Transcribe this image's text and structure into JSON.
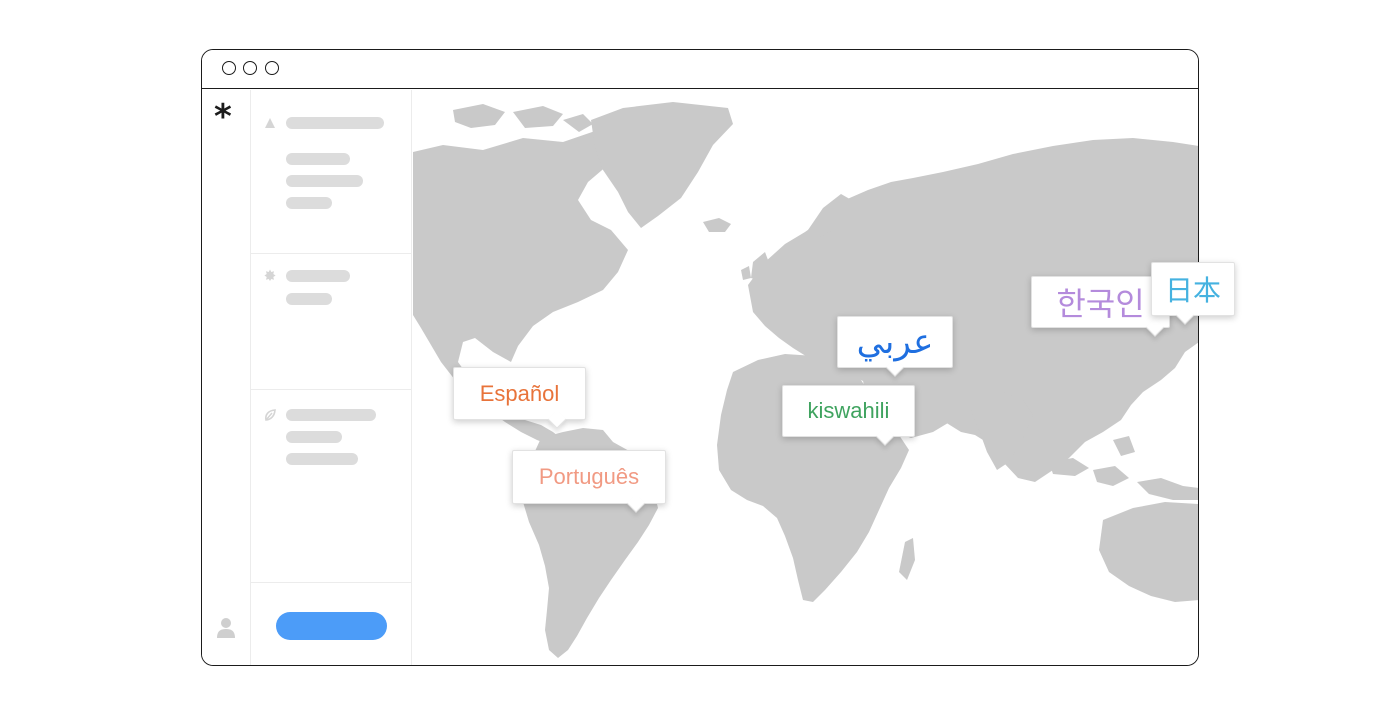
{
  "app": {
    "logo_glyph": "*"
  },
  "colors": {
    "map_land": "#c9c9c9",
    "placeholder": "#dcdcdc",
    "primary_button": "#4c9cf8",
    "espanol": "#e8733a",
    "portugues": "#f19a83",
    "arabic": "#1f6fe0",
    "kiswahili": "#3fa35f",
    "korean": "#b48bdc",
    "japanese": "#45b2e0"
  },
  "sidebar": {
    "sections": [
      {
        "icon": "triangle-icon"
      },
      {
        "icon": "badge-icon"
      },
      {
        "icon": "leaf-icon"
      }
    ]
  },
  "languages": [
    {
      "id": "espanol",
      "label": "Español"
    },
    {
      "id": "portugues",
      "label": "Português"
    },
    {
      "id": "arabic",
      "label": "عربي"
    },
    {
      "id": "kiswahili",
      "label": "kiswahili"
    },
    {
      "id": "korean",
      "label": "한국인"
    },
    {
      "id": "japanese",
      "label": "日本"
    }
  ]
}
